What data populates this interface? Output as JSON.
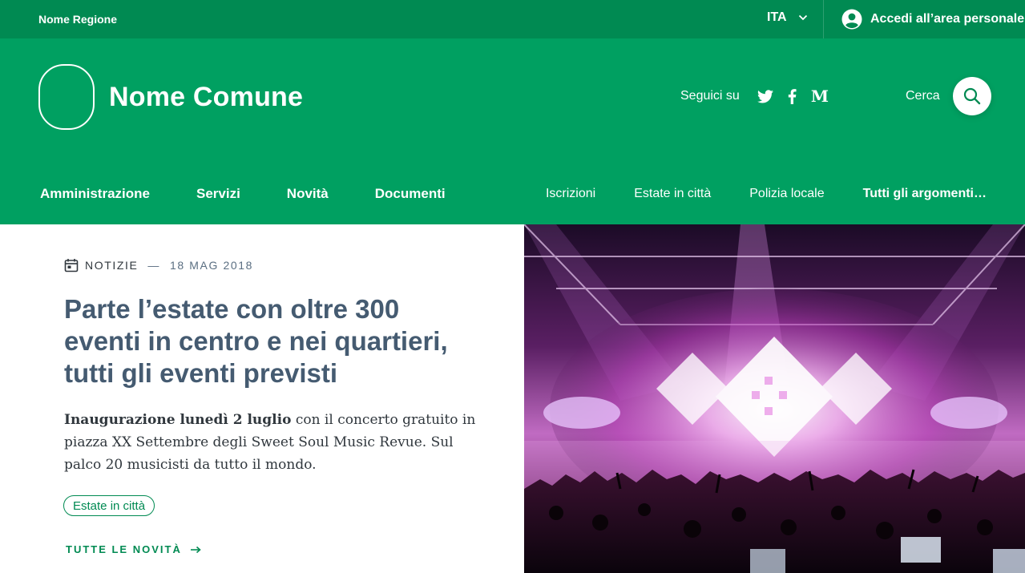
{
  "topbar": {
    "region": "Nome Regione",
    "language": "ITA",
    "login_label": "Accedi all’area personale"
  },
  "header": {
    "site_name": "Nome Comune",
    "follow_label": "Seguici su",
    "social": [
      "twitter-icon",
      "facebook-icon",
      "medium-icon"
    ],
    "medium_letter": "M",
    "search_label": "Cerca"
  },
  "nav": {
    "main": [
      "Amministrazione",
      "Servizi",
      "Novità",
      "Documenti"
    ],
    "secondary": [
      "Iscrizioni",
      "Estate in città",
      "Polizia locale"
    ],
    "all_topics": "Tutti gli argomenti…"
  },
  "hero": {
    "category": "NOTIZIE",
    "separator": "—",
    "date": "18 MAG 2018",
    "title": "Parte l’estate con oltre 300 eventi in centro e nei quartieri, tutti gli eventi previsti",
    "excerpt_bold": "Inaugurazione lunedì 2 luglio",
    "excerpt_rest": " con il concerto gratuito in piazza XX Settembre degli Sweet Soul Music Revue. Sul palco 20 musicisti da tutto il mondo.",
    "tag": "Estate in città",
    "all_news": "TUTTE LE NOVITÀ"
  },
  "colors": {
    "topbar": "#008a52",
    "header": "#00a061",
    "title": "#455b71",
    "accent": "#008a52"
  }
}
